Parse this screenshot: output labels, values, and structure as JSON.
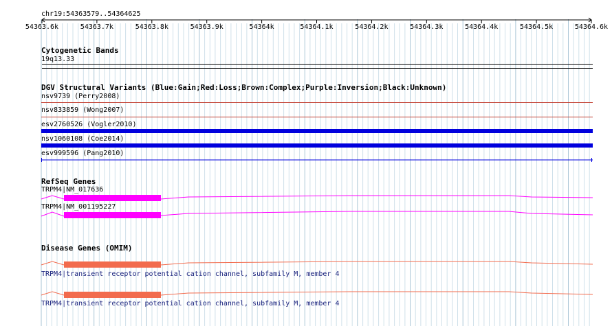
{
  "ruler": {
    "location": "chr19:54363579..54364625",
    "ticks": [
      "54363.6k",
      "54363.7k",
      "54363.8k",
      "54363.9k",
      "54364k",
      "54364.1k",
      "54364.2k",
      "54364.3k",
      "54364.4k",
      "54364.5k",
      "54364.6k"
    ]
  },
  "cytoband": {
    "title": "Cytogenetic Bands",
    "band": "19q13.33"
  },
  "dgv": {
    "title": "DGV Structural Variants (Blue:Gain;Red:Loss;Brown:Complex;Purple:Inversion;Black:Unknown)",
    "items": [
      {
        "label": "nsv9739 (Perry2008)",
        "color": "#c0392b",
        "type": "loss"
      },
      {
        "label": "nsv833859 (Wong2007)",
        "color": "#c0392b",
        "type": "loss"
      },
      {
        "label": "esv2760526 (Vogler2010)",
        "color": "#0000dd",
        "type": "gain"
      },
      {
        "label": "nsv1060108 (Coe2014)",
        "color": "#0000dd",
        "type": "gain"
      },
      {
        "label": "esv999596 (Pang2010)",
        "color": "#0000dd",
        "type": "gain"
      }
    ]
  },
  "refseq": {
    "title": "RefSeq Genes",
    "color": "#ff00ff",
    "genes": [
      {
        "label": "TRPM4|NM_017636"
      },
      {
        "label": "TRPM4|NM_001195227"
      }
    ]
  },
  "omim": {
    "title": "Disease Genes (OMIM)",
    "color": "#f26b4d",
    "genes": [
      {
        "label": "TRPM4|transient receptor potential cation channel, subfamily M, member 4"
      },
      {
        "label": "TRPM4|transient receptor potential cation channel, subfamily M, member 4"
      }
    ]
  }
}
